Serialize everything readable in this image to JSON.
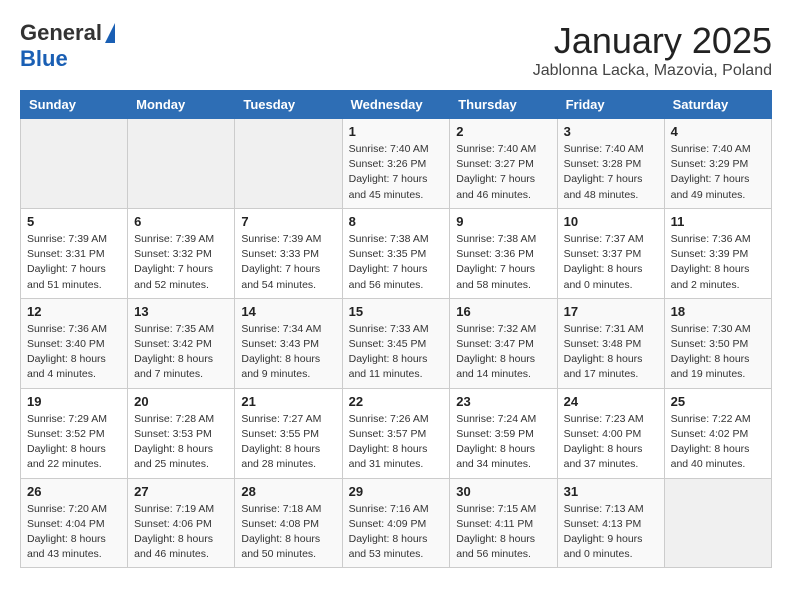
{
  "header": {
    "logo_line1": "General",
    "logo_line2": "Blue",
    "month": "January 2025",
    "location": "Jablonna Lacka, Mazovia, Poland"
  },
  "weekdays": [
    "Sunday",
    "Monday",
    "Tuesday",
    "Wednesday",
    "Thursday",
    "Friday",
    "Saturday"
  ],
  "weeks": [
    [
      {
        "num": "",
        "info": ""
      },
      {
        "num": "",
        "info": ""
      },
      {
        "num": "",
        "info": ""
      },
      {
        "num": "1",
        "info": "Sunrise: 7:40 AM\nSunset: 3:26 PM\nDaylight: 7 hours and 45 minutes."
      },
      {
        "num": "2",
        "info": "Sunrise: 7:40 AM\nSunset: 3:27 PM\nDaylight: 7 hours and 46 minutes."
      },
      {
        "num": "3",
        "info": "Sunrise: 7:40 AM\nSunset: 3:28 PM\nDaylight: 7 hours and 48 minutes."
      },
      {
        "num": "4",
        "info": "Sunrise: 7:40 AM\nSunset: 3:29 PM\nDaylight: 7 hours and 49 minutes."
      }
    ],
    [
      {
        "num": "5",
        "info": "Sunrise: 7:39 AM\nSunset: 3:31 PM\nDaylight: 7 hours and 51 minutes."
      },
      {
        "num": "6",
        "info": "Sunrise: 7:39 AM\nSunset: 3:32 PM\nDaylight: 7 hours and 52 minutes."
      },
      {
        "num": "7",
        "info": "Sunrise: 7:39 AM\nSunset: 3:33 PM\nDaylight: 7 hours and 54 minutes."
      },
      {
        "num": "8",
        "info": "Sunrise: 7:38 AM\nSunset: 3:35 PM\nDaylight: 7 hours and 56 minutes."
      },
      {
        "num": "9",
        "info": "Sunrise: 7:38 AM\nSunset: 3:36 PM\nDaylight: 7 hours and 58 minutes."
      },
      {
        "num": "10",
        "info": "Sunrise: 7:37 AM\nSunset: 3:37 PM\nDaylight: 8 hours and 0 minutes."
      },
      {
        "num": "11",
        "info": "Sunrise: 7:36 AM\nSunset: 3:39 PM\nDaylight: 8 hours and 2 minutes."
      }
    ],
    [
      {
        "num": "12",
        "info": "Sunrise: 7:36 AM\nSunset: 3:40 PM\nDaylight: 8 hours and 4 minutes."
      },
      {
        "num": "13",
        "info": "Sunrise: 7:35 AM\nSunset: 3:42 PM\nDaylight: 8 hours and 7 minutes."
      },
      {
        "num": "14",
        "info": "Sunrise: 7:34 AM\nSunset: 3:43 PM\nDaylight: 8 hours and 9 minutes."
      },
      {
        "num": "15",
        "info": "Sunrise: 7:33 AM\nSunset: 3:45 PM\nDaylight: 8 hours and 11 minutes."
      },
      {
        "num": "16",
        "info": "Sunrise: 7:32 AM\nSunset: 3:47 PM\nDaylight: 8 hours and 14 minutes."
      },
      {
        "num": "17",
        "info": "Sunrise: 7:31 AM\nSunset: 3:48 PM\nDaylight: 8 hours and 17 minutes."
      },
      {
        "num": "18",
        "info": "Sunrise: 7:30 AM\nSunset: 3:50 PM\nDaylight: 8 hours and 19 minutes."
      }
    ],
    [
      {
        "num": "19",
        "info": "Sunrise: 7:29 AM\nSunset: 3:52 PM\nDaylight: 8 hours and 22 minutes."
      },
      {
        "num": "20",
        "info": "Sunrise: 7:28 AM\nSunset: 3:53 PM\nDaylight: 8 hours and 25 minutes."
      },
      {
        "num": "21",
        "info": "Sunrise: 7:27 AM\nSunset: 3:55 PM\nDaylight: 8 hours and 28 minutes."
      },
      {
        "num": "22",
        "info": "Sunrise: 7:26 AM\nSunset: 3:57 PM\nDaylight: 8 hours and 31 minutes."
      },
      {
        "num": "23",
        "info": "Sunrise: 7:24 AM\nSunset: 3:59 PM\nDaylight: 8 hours and 34 minutes."
      },
      {
        "num": "24",
        "info": "Sunrise: 7:23 AM\nSunset: 4:00 PM\nDaylight: 8 hours and 37 minutes."
      },
      {
        "num": "25",
        "info": "Sunrise: 7:22 AM\nSunset: 4:02 PM\nDaylight: 8 hours and 40 minutes."
      }
    ],
    [
      {
        "num": "26",
        "info": "Sunrise: 7:20 AM\nSunset: 4:04 PM\nDaylight: 8 hours and 43 minutes."
      },
      {
        "num": "27",
        "info": "Sunrise: 7:19 AM\nSunset: 4:06 PM\nDaylight: 8 hours and 46 minutes."
      },
      {
        "num": "28",
        "info": "Sunrise: 7:18 AM\nSunset: 4:08 PM\nDaylight: 8 hours and 50 minutes."
      },
      {
        "num": "29",
        "info": "Sunrise: 7:16 AM\nSunset: 4:09 PM\nDaylight: 8 hours and 53 minutes."
      },
      {
        "num": "30",
        "info": "Sunrise: 7:15 AM\nSunset: 4:11 PM\nDaylight: 8 hours and 56 minutes."
      },
      {
        "num": "31",
        "info": "Sunrise: 7:13 AM\nSunset: 4:13 PM\nDaylight: 9 hours and 0 minutes."
      },
      {
        "num": "",
        "info": ""
      }
    ]
  ]
}
